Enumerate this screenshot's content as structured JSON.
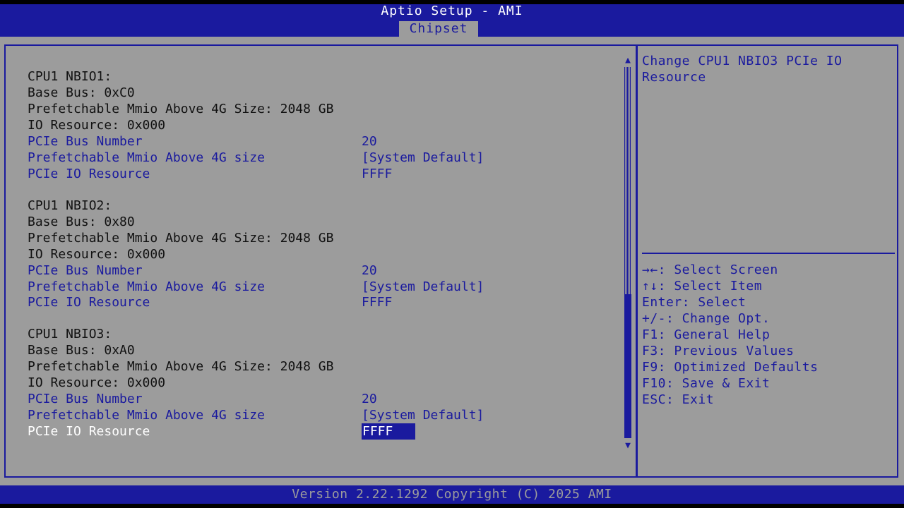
{
  "header": {
    "title": "Aptio Setup - AMI",
    "active_tab": "Chipset"
  },
  "colors": {
    "bios_blue": "#1a1a9e",
    "bios_gray": "#9c9c9c",
    "text_dark": "#111111",
    "highlight_text": "#ffffff"
  },
  "groups": [
    {
      "heading": "CPU1 NBIO1:",
      "base_bus": "Base Bus: 0xC0",
      "mmio_size": "Prefetchable Mmio Above 4G Size: 2048 GB",
      "io_resource": "IO Resource: 0x000",
      "options": [
        {
          "label": "PCIe Bus Number",
          "value": "20"
        },
        {
          "label": "Prefetchable Mmio Above 4G size",
          "value": "[System Default]"
        },
        {
          "label": "PCIe IO Resource",
          "value": "FFFF"
        }
      ]
    },
    {
      "heading": "CPU1 NBIO2:",
      "base_bus": "Base Bus: 0x80",
      "mmio_size": "Prefetchable Mmio Above 4G Size: 2048 GB",
      "io_resource": "IO Resource: 0x000",
      "options": [
        {
          "label": "PCIe Bus Number",
          "value": "20"
        },
        {
          "label": "Prefetchable Mmio Above 4G size",
          "value": "[System Default]"
        },
        {
          "label": "PCIe IO Resource",
          "value": "FFFF"
        }
      ]
    },
    {
      "heading": "CPU1 NBIO3:",
      "base_bus": "Base Bus: 0xA0",
      "mmio_size": "Prefetchable Mmio Above 4G Size: 2048 GB",
      "io_resource": "IO Resource: 0x000",
      "options": [
        {
          "label": "PCIe Bus Number",
          "value": "20"
        },
        {
          "label": "Prefetchable Mmio Above 4G size",
          "value": "[System Default]"
        },
        {
          "label": "PCIe IO Resource",
          "value": "FFFF"
        }
      ]
    }
  ],
  "help_text": "Change CPU1 NBIO3 PCIe IO Resource",
  "key_help": [
    "→←: Select Screen",
    "↑↓: Select Item",
    "Enter: Select",
    "+/-: Change Opt.",
    "F1: General Help",
    "F3: Previous Values",
    "F9: Optimized Defaults",
    "F10: Save & Exit",
    "ESC: Exit"
  ],
  "footer": {
    "version": "Version 2.22.1292 Copyright (C) 2025 AMI"
  },
  "scrollbar": {
    "up_arrow": "▲",
    "down_arrow": "▼"
  }
}
